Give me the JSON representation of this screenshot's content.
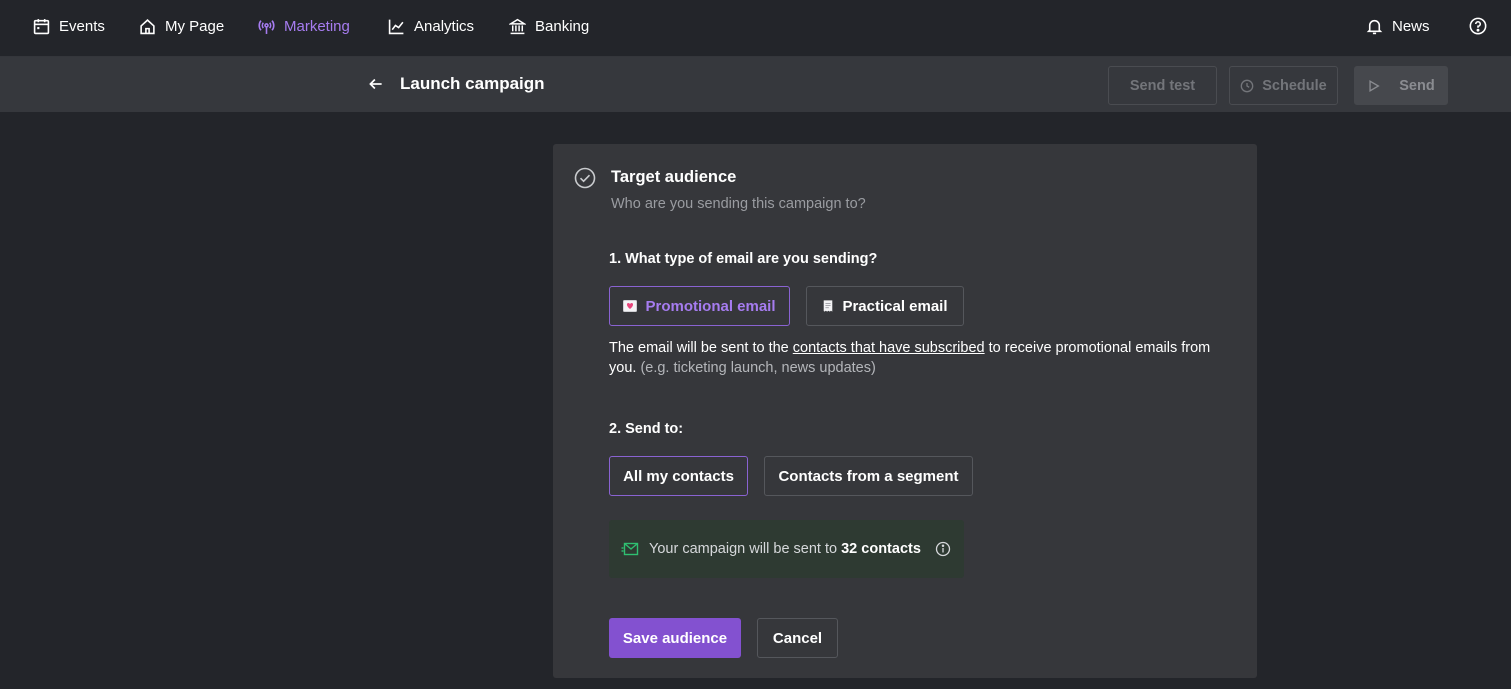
{
  "nav": {
    "items": [
      {
        "label": "Events",
        "icon": "calendar-icon"
      },
      {
        "label": "My Page",
        "icon": "home-icon"
      },
      {
        "label": "Marketing",
        "icon": "broadcast-icon",
        "active": true
      },
      {
        "label": "Analytics",
        "icon": "chart-line-icon"
      },
      {
        "label": "Banking",
        "icon": "bank-icon"
      }
    ],
    "news_label": "News",
    "help_icon": "help-circle-icon"
  },
  "header": {
    "title": "Launch campaign",
    "send_test_label": "Send test",
    "schedule_label": "Schedule",
    "send_label": "Send"
  },
  "card": {
    "title": "Target audience",
    "subtitle": "Who are you sending this campaign to?",
    "q1": "1. What type of email are you sending?",
    "promo_label": "Promotional email",
    "practical_label": "Practical email",
    "desc_part1": "The email will be sent to the ",
    "desc_link": "contacts that have subscribed",
    "desc_part2": " to receive promotional emails from you.",
    "desc_example": " (e.g. ticketing launch, news updates)",
    "q2": "2. Send to:",
    "all_contacts_label": "All my contacts",
    "segment_label": "Contacts from a segment",
    "info_prefix": "Your campaign will be sent to ",
    "info_count": "32 contacts",
    "save_label": "Save audience",
    "cancel_label": "Cancel"
  },
  "colors": {
    "accent": "#a67cf0",
    "primary_button": "#8351d0",
    "success_icon": "#2fbf71"
  }
}
